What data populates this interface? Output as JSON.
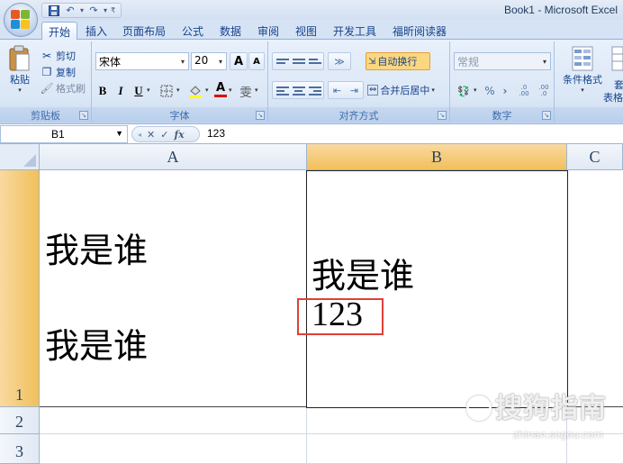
{
  "window": {
    "title": "Book1 - Microsoft Excel"
  },
  "quick_access": {
    "customize_label": "₹"
  },
  "tabs": [
    {
      "label": "开始",
      "active": true
    },
    {
      "label": "插入"
    },
    {
      "label": "页面布局"
    },
    {
      "label": "公式"
    },
    {
      "label": "数据"
    },
    {
      "label": "审阅"
    },
    {
      "label": "视图"
    },
    {
      "label": "开发工具"
    },
    {
      "label": "福昕阅读器"
    }
  ],
  "clipboard": {
    "group_label": "剪贴板",
    "paste_label": "粘贴",
    "cut_label": "剪切",
    "copy_label": "复制",
    "format_painter_label": "格式刷"
  },
  "font": {
    "group_label": "字体",
    "font_name": "宋体",
    "font_size": "20",
    "grow_label": "A",
    "shrink_label": "A",
    "bold_label": "B",
    "italic_label": "I",
    "underline_label": "U",
    "font_color_label": "A",
    "phonetic_label": "雯"
  },
  "alignment": {
    "group_label": "对齐方式",
    "wrap_text_label": "自动换行",
    "merge_center_label": "合并后居中"
  },
  "number": {
    "group_label": "数字",
    "format_value": "常规",
    "percent_label": "%",
    "comma_label": "›",
    "inc_decimal_label": ".0 .00",
    "dec_decimal_label": ".00 .0"
  },
  "styles": {
    "conditional_format_label": "条件格式",
    "table_format_partial": "表格",
    "table_format_partial_top": "套"
  },
  "formula_bar": {
    "name_box_value": "B1",
    "cancel_label": "✕",
    "enter_label": "✓",
    "fx_label": "fx",
    "content": "123"
  },
  "sheet": {
    "columns": [
      "A",
      "B",
      "C"
    ],
    "rows": [
      "1",
      "2",
      "3"
    ],
    "cells": {
      "A1_line1": "我是谁",
      "A1_line2": "我是谁",
      "B1_line1": "我是谁",
      "B1_line2": "123"
    }
  },
  "watermark": {
    "text": "搜狗指南",
    "url": "zhinan.sogou.com"
  },
  "colors": {
    "ribbon_bg": "#dbe7f6",
    "selected_header": "#f1c05c",
    "highlight_box": "#e0403a",
    "wrap_text_active": "#fbd77f"
  }
}
